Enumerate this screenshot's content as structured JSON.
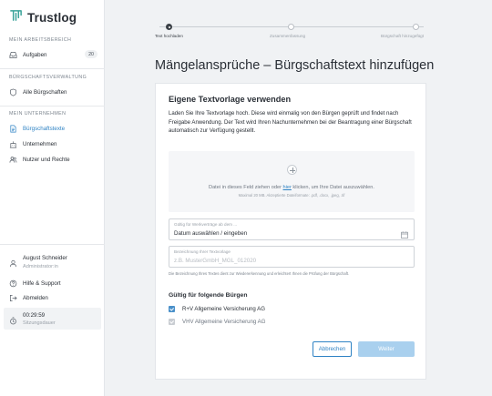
{
  "app": {
    "name": "Trustlog"
  },
  "colors": {
    "accent": "#2f83c4",
    "active_nav": "#2f83c4",
    "button_disabled": "#a9d0ee"
  },
  "sidebar": {
    "sections": [
      {
        "label": "MEIN ARBEITSBEREICH",
        "items": [
          {
            "label": "Aufgaben",
            "icon": "inbox-icon",
            "badge": "20"
          }
        ]
      },
      {
        "label": "BÜRGSCHAFTSVERWALTUNG",
        "items": [
          {
            "label": "Alle Bürgschaften",
            "icon": "shield-icon"
          }
        ]
      },
      {
        "label": "MEIN UNTERNEHMEN",
        "items": [
          {
            "label": "Bürgschaftstexte",
            "icon": "document-icon",
            "active": true
          },
          {
            "label": "Unternehmen",
            "icon": "building-icon"
          },
          {
            "label": "Nutzer und Rechte",
            "icon": "users-icon"
          }
        ]
      }
    ],
    "user": {
      "name": "August Schneider",
      "role": "Administrator:in"
    },
    "footer_items": [
      {
        "label": "Hilfe & Support",
        "icon": "help-icon"
      },
      {
        "label": "Abmelden",
        "icon": "logout-icon"
      }
    ],
    "session": {
      "time": "00:29:59",
      "label": "Sitzungsdauer"
    }
  },
  "stepper": {
    "steps": [
      {
        "label": "Text hochladen",
        "active": true
      },
      {
        "label": "Zusammenfassung",
        "active": false
      },
      {
        "label": "Bürgschaft hinzugefügt",
        "active": false
      }
    ]
  },
  "page": {
    "title": "Mängelansprüche – Bürgschaftstext hinzufügen"
  },
  "card": {
    "title": "Eigene Textvorlage verwenden",
    "description_pre": "Laden Sie Ihre Textvorlage hoch. Diese wird einmalig von den Bürgen geprüft und findet nach Freigabe Anwendung. Der Text wird Ihren Nachunternehmen bei der Beantragung einer Bürgschaft automatisch zur Verfügung gestellt.",
    "dropzone": {
      "text_pre": "Datei in dieses Feld ziehen oder",
      "link": "hier",
      "text_post": "klicken, um Ihre Datei auszuwählen.",
      "hint": "Maximal 20 MB. Akzeptierte Dateiformate: .pdf, .docx, .jpeg, .tif"
    },
    "date_field": {
      "label": "Gültig für Werkverträge ab dem ...",
      "value": "Datum auswählen / eingeben"
    },
    "name_field": {
      "label": "Bezeichnung Ihrer Textvorlage",
      "placeholder": "z.B. MusterGmbH_MGL_012020"
    },
    "help_text": "Die Bezeichnung Ihres Textes dient zur Wiedererkennung und erleichtert Ihnen die Prüfung der Bürgschaft.",
    "guarantors": {
      "title": "Gültig für folgende Bürgen",
      "items": [
        {
          "label": "R+V Allgemeine Versicherung AG",
          "checked": true,
          "disabled": false
        },
        {
          "label": "VHV Allgemeine Versicherung AG",
          "checked": true,
          "disabled": true
        }
      ]
    },
    "buttons": {
      "cancel": "Abbrechen",
      "next": "Weiter"
    }
  }
}
